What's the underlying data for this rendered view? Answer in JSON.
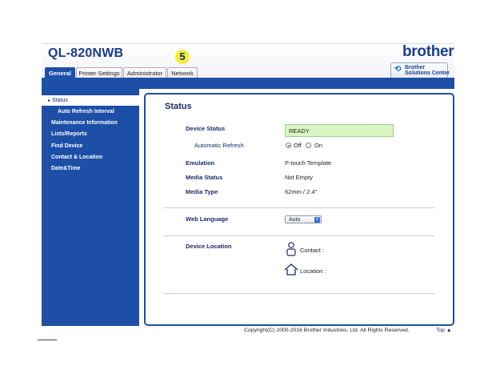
{
  "header": {
    "model": "QL-820NWB",
    "brand": "brother",
    "solutions_center": "Brother\nSolutions Center",
    "step_badge": "5"
  },
  "tabs": [
    {
      "label": "General",
      "active": true
    },
    {
      "label": "Printer Settings",
      "active": false
    },
    {
      "label": "Administrator",
      "active": false
    },
    {
      "label": "Network",
      "active": false
    }
  ],
  "sidebar": {
    "items": [
      {
        "label": "Status",
        "selected": true
      },
      {
        "label": "Auto Refresh Interval"
      },
      {
        "label": "Maintenance Information"
      },
      {
        "label": "Lists/Reports"
      },
      {
        "label": "Find Device"
      },
      {
        "label": "Contact & Location"
      },
      {
        "label": "Date&Time"
      }
    ]
  },
  "main": {
    "title": "Status",
    "device_status_label": "Device Status",
    "device_status_value": "READY",
    "auto_refresh_label": "Automatic Refresh",
    "auto_refresh_off": "Off",
    "auto_refresh_on": "On",
    "auto_refresh_selected": "Off",
    "emulation_label": "Emulation",
    "emulation_value": "P-touch Template",
    "media_status_label": "Media Status",
    "media_status_value": "Not Empty",
    "media_type_label": "Media Type",
    "media_type_value": "62mm / 2.4\"",
    "web_language_label": "Web Language",
    "web_language_value": "Auto",
    "device_location_label": "Device Location",
    "contact_label": "Contact :",
    "location_label": "Location :"
  },
  "footer": {
    "copyright": "Copyright(C) 2000-2016 Brother Industries, Ltd. All Rights Reserved.",
    "top_link": "Top ▲"
  },
  "colors": {
    "brand_blue": "#1d4fa6",
    "ready_green": "#d8f5c4",
    "badge_yellow": "#f4ef3c"
  }
}
